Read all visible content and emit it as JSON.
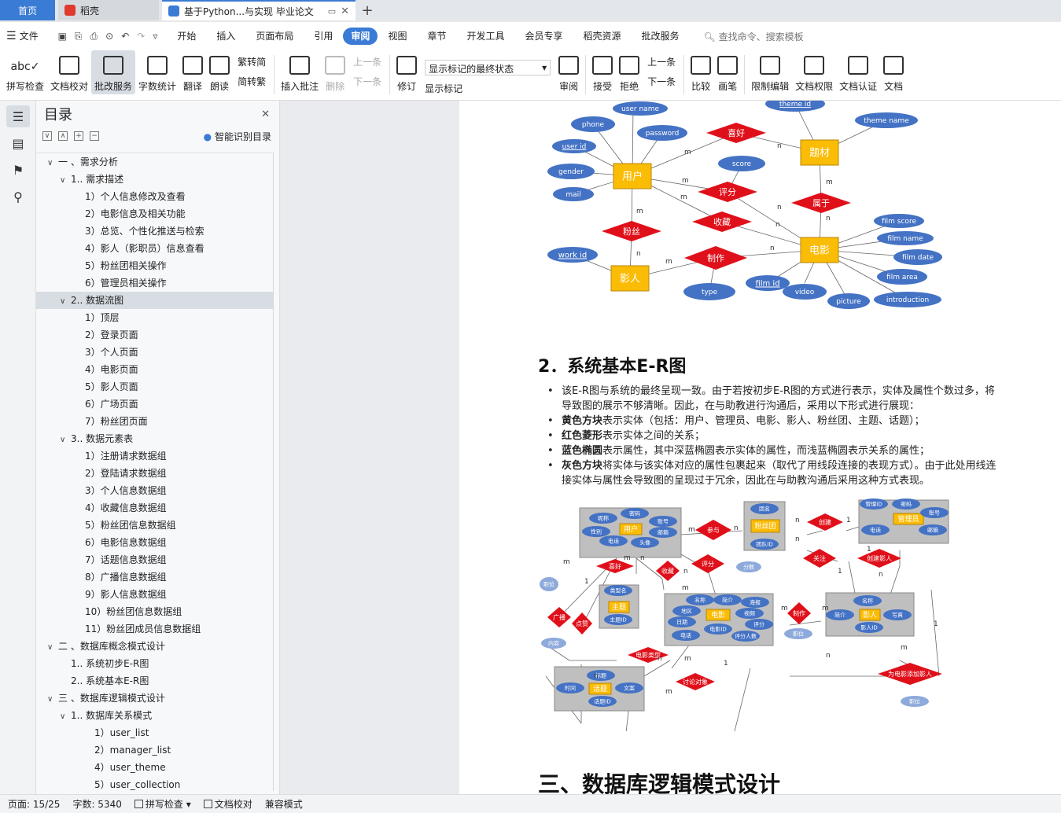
{
  "tabs": {
    "home": "首页",
    "docer": "稻壳",
    "doc_title": "基于Python...与实现 毕业论文"
  },
  "menu": {
    "file": "文件",
    "items": [
      "开始",
      "插入",
      "页面布局",
      "引用",
      "审阅",
      "视图",
      "章节",
      "开发工具",
      "会员专享",
      "稻壳资源",
      "批改服务"
    ],
    "active": "审阅",
    "search_placeholder": "查找命令、搜索模板"
  },
  "ribbon": {
    "spell": "拼写检查",
    "doc_check": "文档校对",
    "review_service": "批改服务",
    "word_count": "字数统计",
    "translate": "翻译",
    "read_aloud": "朗读",
    "trad": "繁转简",
    "simp": "简转繁",
    "insert_comment": "插入批注",
    "delete": "删除",
    "prev": "上一条",
    "next": "下一条",
    "revise": "修订",
    "show_final": "显示标记的最终状态",
    "show_marks": "显示标记",
    "review": "审阅",
    "accept": "接受",
    "reject": "拒绝",
    "prev2": "上一条",
    "next2": "下一条",
    "compare": "比较",
    "pen": "画笔",
    "restrict": "限制编辑",
    "doc_perm": "文档权限",
    "doc_auth": "文档认证",
    "doc_cut": "文档"
  },
  "toc": {
    "title": "目录",
    "smart": "智能识别目录",
    "items": [
      {
        "text": "一 、需求分析",
        "level": 0,
        "caret": "∨"
      },
      {
        "text": "1.. 需求描述",
        "level": 1,
        "caret": "∨"
      },
      {
        "text": "1）个人信息修改及查看",
        "level": 2,
        "caret": ""
      },
      {
        "text": "2）电影信息及相关功能",
        "level": 2,
        "caret": ""
      },
      {
        "text": "3）总览、个性化推送与检索",
        "level": 2,
        "caret": ""
      },
      {
        "text": "4）影人（影职员）信息查看",
        "level": 2,
        "caret": ""
      },
      {
        "text": "5）粉丝团相关操作",
        "level": 2,
        "caret": ""
      },
      {
        "text": "6）管理员相关操作",
        "level": 2,
        "caret": ""
      },
      {
        "text": "2.. 数据流图",
        "level": 1,
        "caret": "∨",
        "selected": true
      },
      {
        "text": "1）顶层",
        "level": 2,
        "caret": ""
      },
      {
        "text": "2）登录页面",
        "level": 2,
        "caret": ""
      },
      {
        "text": "3）个人页面",
        "level": 2,
        "caret": ""
      },
      {
        "text": "4）电影页面",
        "level": 2,
        "caret": ""
      },
      {
        "text": "5）影人页面",
        "level": 2,
        "caret": ""
      },
      {
        "text": "6）广场页面",
        "level": 2,
        "caret": ""
      },
      {
        "text": "7）粉丝团页面",
        "level": 2,
        "caret": ""
      },
      {
        "text": "3.. 数据元素表",
        "level": 1,
        "caret": "∨"
      },
      {
        "text": "1）注册请求数据组",
        "level": 2,
        "caret": ""
      },
      {
        "text": "2）登陆请求数据组",
        "level": 2,
        "caret": ""
      },
      {
        "text": "3）个人信息数据组",
        "level": 2,
        "caret": ""
      },
      {
        "text": "4）收藏信息数据组",
        "level": 2,
        "caret": ""
      },
      {
        "text": "5）粉丝团信息数据组",
        "level": 2,
        "caret": ""
      },
      {
        "text": "6）电影信息数据组",
        "level": 2,
        "caret": ""
      },
      {
        "text": "7）话题信息数据组",
        "level": 2,
        "caret": ""
      },
      {
        "text": "8）广播信息数据组",
        "level": 2,
        "caret": ""
      },
      {
        "text": "9）影人信息数据组",
        "level": 2,
        "caret": ""
      },
      {
        "text": "10）粉丝团信息数据组",
        "level": 2,
        "caret": ""
      },
      {
        "text": "11）粉丝团成员信息数据组",
        "level": 2,
        "caret": ""
      },
      {
        "text": "二 、数据库概念模式设计",
        "level": 0,
        "caret": "∨"
      },
      {
        "text": "1.. 系统初步E-R图",
        "level": 1,
        "caret": ""
      },
      {
        "text": "2.. 系统基本E-R图",
        "level": 1,
        "caret": ""
      },
      {
        "text": "三 、数据库逻辑模式设计",
        "level": 0,
        "caret": "∨"
      },
      {
        "text": "1.. 数据库关系模式",
        "level": 1,
        "caret": "∨"
      },
      {
        "text": "1）user_list",
        "level": 3,
        "caret": ""
      },
      {
        "text": "2）manager_list",
        "level": 3,
        "caret": ""
      },
      {
        "text": "4）user_theme",
        "level": 3,
        "caret": ""
      },
      {
        "text": "5）user_collection",
        "level": 3,
        "caret": ""
      }
    ]
  },
  "doc": {
    "section_title": "2．系统基本E-R图",
    "bullet1": "该E-R图与系统的最终呈现一致。由于若按初步E-R图的方式进行表示，实体及属性个数过多，将导致图的展示不够清晰。因此，在与助教进行沟通后，采用以下形式进行展现：",
    "bullet2_b": "黄色方块",
    "bullet2": "表示实体（包括：用户、管理员、电影、影人、粉丝团、主题、话题）；",
    "bullet3_b": "红色菱形",
    "bullet3": "表示实体之间的关系；",
    "bullet4_b": "蓝色椭圆",
    "bullet4": "表示属性，其中深蓝椭圆表示实体的属性，而浅蓝椭圆表示关系的属性；",
    "bullet5_b": "灰色方块",
    "bullet5": "将实体与该实体对应的属性包裹起来（取代了用线段连接的表现方式）。由于此处用线连接实体与属性会导致图的呈现过于冗余，因此在与助教沟通后采用这种方式表现。",
    "chapter_title": "三、数据库逻辑模式设计",
    "er1": {
      "entities": [
        "用户",
        "题材",
        "电影",
        "影人"
      ],
      "relations": [
        "喜好",
        "评分",
        "属于",
        "收藏",
        "粉丝",
        "制作"
      ],
      "attributes": [
        "user name",
        "phone",
        "password",
        "user id",
        "gender",
        "mail",
        "score",
        "theme id",
        "theme name",
        "film score",
        "film name",
        "film date",
        "film area",
        "introduction",
        "picture",
        "video",
        "film id",
        "type",
        "work id"
      ],
      "cardinalities": [
        "m",
        "n"
      ]
    },
    "er2": {
      "entities": [
        "用户",
        "粉丝团",
        "管理员",
        "主题",
        "电影",
        "影人",
        "话题"
      ],
      "relations": [
        "参与",
        "创建",
        "关注",
        "创建影人",
        "喜好",
        "收藏",
        "评分",
        "广播",
        "点赞",
        "电影类型",
        "制作",
        "讨论对象",
        "为电影添加影人"
      ],
      "attributes": [
        "昵称",
        "密码",
        "账号",
        "性别",
        "邮箱",
        "电话",
        "头像",
        "团名",
        "团队ID",
        "管理ID",
        "类型名",
        "主题ID",
        "名称",
        "简介",
        "海报",
        "地区",
        "视频",
        "日期",
        "评分",
        "电影ID",
        "评分人数",
        "写真",
        "影人ID",
        "标题",
        "时间",
        "文案",
        "话题ID",
        "分数",
        "内容",
        "职位"
      ]
    }
  },
  "status": {
    "page": "页面: 15/25",
    "words": "字数: 5340",
    "spell": "拼写检查",
    "proof": "文档校对",
    "compat": "兼容模式"
  },
  "colors": {
    "accent": "#3a7bd5",
    "entity": "#fbbc05",
    "relation": "#e0101a",
    "attribute": "#4472c4",
    "light_attribute": "#8eaadb",
    "group_box": "#bfbfbf"
  }
}
